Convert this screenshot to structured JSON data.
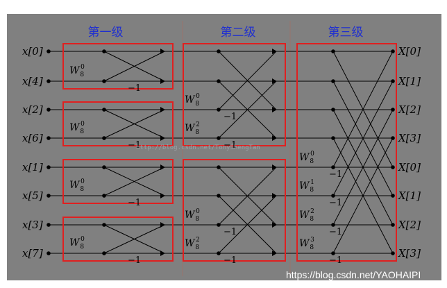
{
  "stages": [
    "第一级",
    "第二级",
    "第三级"
  ],
  "inputs": [
    "x[0]",
    "x[4]",
    "x[2]",
    "x[6]",
    "x[1]",
    "x[5]",
    "x[3]",
    "x[7]"
  ],
  "outputs": [
    "X[0]",
    "X[1]",
    "X[2]",
    "X[3]",
    "X[0]",
    "X[1]",
    "X[2]",
    "X[3]"
  ],
  "twiddle_base": "W",
  "twiddle_subscript": "8",
  "stage1_twiddles": [
    "0",
    "0",
    "0",
    "0"
  ],
  "stage2_twiddles": [
    "0",
    "2",
    "0",
    "2"
  ],
  "stage3_twiddles": [
    "0",
    "1",
    "2",
    "3"
  ],
  "negation_label": "−1",
  "watermark_mid": "http://blog.csdn.net/TonyShengTan",
  "watermark_footer": "https://blog.csdn.net/YAOHAIPI",
  "colors": {
    "background": "#808080",
    "box": "#e02020",
    "stage_title": "#1f2fd0",
    "line": "#000000"
  }
}
